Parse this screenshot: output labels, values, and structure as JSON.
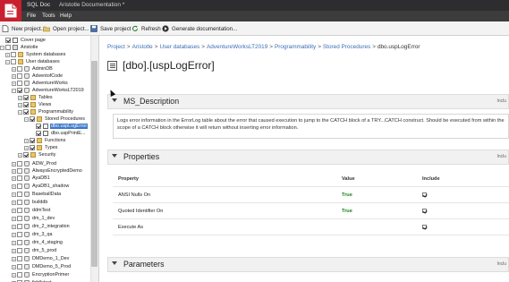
{
  "window": {
    "app": "SQL Doc",
    "document": "Aristotle Documentation *"
  },
  "menu": [
    "File",
    "Tools",
    "Help"
  ],
  "toolbar": {
    "new_project": "New project...",
    "open_project": "Open project...",
    "save_project": "Save project",
    "refresh": "Refresh",
    "generate": "Generate documentation..."
  },
  "tree": {
    "cover_page": "Cover page",
    "server": "Aristotle",
    "system_databases": "System databases",
    "user_databases": "User databases",
    "dbs_before": [
      "AdminDB",
      "AdventofCode",
      "AdventureWorks"
    ],
    "current_db": "AdventureWorksLT2019",
    "tables": "Tables",
    "views": "Views",
    "programmability": "Programmability",
    "stored_procedures": "Stored Procedures",
    "proc_selected": "dbo.uspLogError",
    "proc_other": "dbo.uspPrintE...",
    "functions": "Functions",
    "types": "Types",
    "security": "Security",
    "dbs_after": [
      "ADW_Prod",
      "AlwaysEncryptedDemo",
      "AyaDB1",
      "AyaDB1_shadow",
      "BaseballData",
      "builddb",
      "ddmTest",
      "dm_1_dev",
      "dm_2_integration",
      "dm_3_qa",
      "dm_4_staging",
      "dm_5_prod",
      "DMDemo_1_Dev",
      "DMDemo_5_Prod",
      "EncryptionPrimer",
      "fiddletest"
    ]
  },
  "main": {
    "breadcrumb": [
      "Project",
      "Aristotle",
      "User databases",
      "AdventureWorksLT2019",
      "Programmability",
      "Stored Procedures"
    ],
    "breadcrumb_current": "dbo.uspLogError",
    "breadcrumb_sep": ">",
    "title": "[dbo].[uspLogError]",
    "include_label": "Inclu",
    "sections": {
      "description": "MS_Description",
      "properties": "Properties",
      "parameters": "Parameters"
    },
    "description_text": "Logs error information in the ErrorLog table about the error that caused execution to jump to the CATCH block of a TRY...CATCH construct. Should be executed from within the scope of a CATCH block otherwise it will return without inserting error information.",
    "properties": {
      "headers": {
        "property": "Property",
        "value": "Value",
        "include": "Include"
      },
      "rows": [
        {
          "property": "ANSI Nulls On",
          "value": "True",
          "include": true
        },
        {
          "property": "Quoted Identifier On",
          "value": "True",
          "include": true
        },
        {
          "property": "Execute As",
          "value": "",
          "include": true
        }
      ]
    }
  },
  "colors": {
    "title_bar": "#2d2d30",
    "logo": "#c8202f",
    "link": "#3a6fb5",
    "true_value": "#1a7f1a",
    "selection": "#3a78c9"
  }
}
